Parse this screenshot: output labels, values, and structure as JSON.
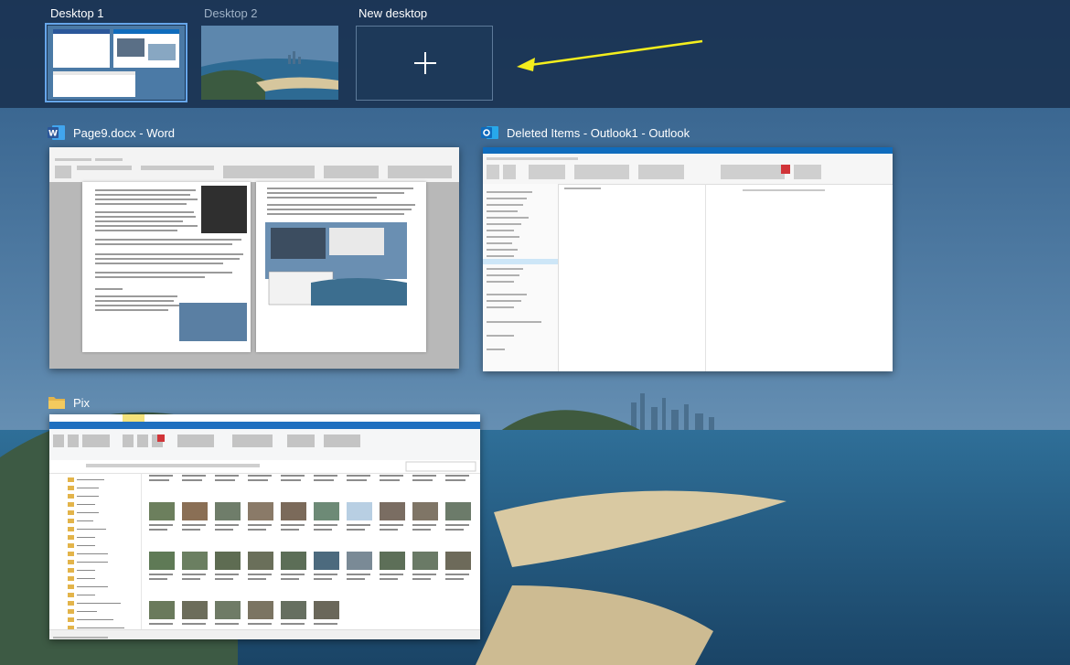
{
  "desktops": [
    {
      "label": "Desktop 1",
      "active": true
    },
    {
      "label": "Desktop 2",
      "active": false
    }
  ],
  "new_desktop": {
    "label": "New desktop"
  },
  "windows": {
    "word": {
      "title": "Page9.docx - Word",
      "icon": "word-icon"
    },
    "outlook": {
      "title": "Deleted Items - Outlook1 - Outlook",
      "icon": "outlook-icon"
    },
    "explorer": {
      "title": "Pix",
      "icon": "folder-icon"
    }
  },
  "colors": {
    "strip": "#1b3453",
    "accent": "#66a6ea",
    "arrow": "#f4ee1d",
    "word": "#2b579a",
    "outlook": "#0f6cbd",
    "folder": "#e3b44a"
  }
}
